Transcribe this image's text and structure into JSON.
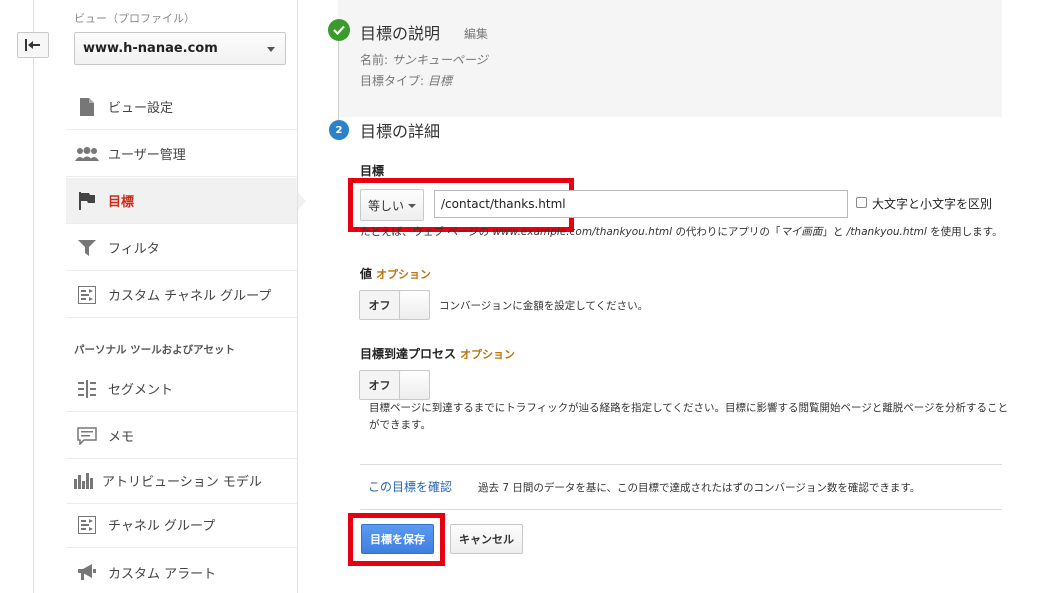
{
  "sidebar": {
    "view_label": "ビュー（プロファイル）",
    "view_value": "www.h-nanae.com",
    "section_heading": "パーソナル ツールおよびアセット",
    "items": [
      {
        "label": "ビュー設定",
        "icon": "document-icon"
      },
      {
        "label": "ユーザー管理",
        "icon": "users-icon"
      },
      {
        "label": "目標",
        "icon": "flag-icon"
      },
      {
        "label": "フィルタ",
        "icon": "filter-icon"
      },
      {
        "label": "カスタム チャネル グループ",
        "icon": "channel-group-icon"
      },
      {
        "label": "セグメント",
        "icon": "segment-icon"
      },
      {
        "label": "メモ",
        "icon": "memo-icon"
      },
      {
        "label": "アトリビューション モデル",
        "icon": "bar-chart-icon"
      },
      {
        "label": "チャネル グループ",
        "icon": "channel-group-icon"
      },
      {
        "label": "カスタム アラート",
        "icon": "megaphone-icon"
      }
    ],
    "active_index": 2
  },
  "step1": {
    "title": "目標の説明",
    "edit_label": "編集",
    "name_label": "名前:",
    "name_value": "サンキューページ",
    "type_label": "目標タイプ:",
    "type_value": "目標"
  },
  "step2": {
    "number": "2",
    "title": "目標の詳細",
    "goal_label": "目標",
    "match_type": "等しい",
    "url_value": "/contact/thanks.html",
    "case_label": "大文字と小文字を区別",
    "hint_prefix": "たとえば、ウェブ ページの",
    "hint_example_url": "www.example.com/thankyou.html",
    "hint_middle": "の代わりにアプリの「",
    "hint_example_screen": "マイ画面",
    "hint_and": "」と",
    "hint_example_path": "/thankyou.html",
    "hint_suffix": "を使用します。",
    "value_label": "値",
    "value_option": "オプション",
    "value_toggle": "オフ",
    "value_hint": "コンバージョンに金額を設定してください。",
    "funnel_label": "目標到達プロセス",
    "funnel_option": "オプション",
    "funnel_toggle": "オフ",
    "funnel_hint": "目標ページに到達するまでにトラフィックが辿る経路を指定してください。目標に影響する閲覧開始ページと離脱ページを分析することができます。",
    "verify_link": "この目標を確認",
    "verify_hint": "過去 7 日間のデータを基に、この目標で達成されたはずのコンバージョン数を確認できます。",
    "save_label": "目標を保存",
    "cancel_label": "キャンセル"
  },
  "colors": {
    "highlight_red": "#e60012",
    "active_nav_text": "#cc2c1e",
    "save_button": "#4a8af0",
    "step_check": "#3a9a2b",
    "step_number": "#2a82c9",
    "option_text": "#b8770f",
    "link": "#2a66b0"
  }
}
